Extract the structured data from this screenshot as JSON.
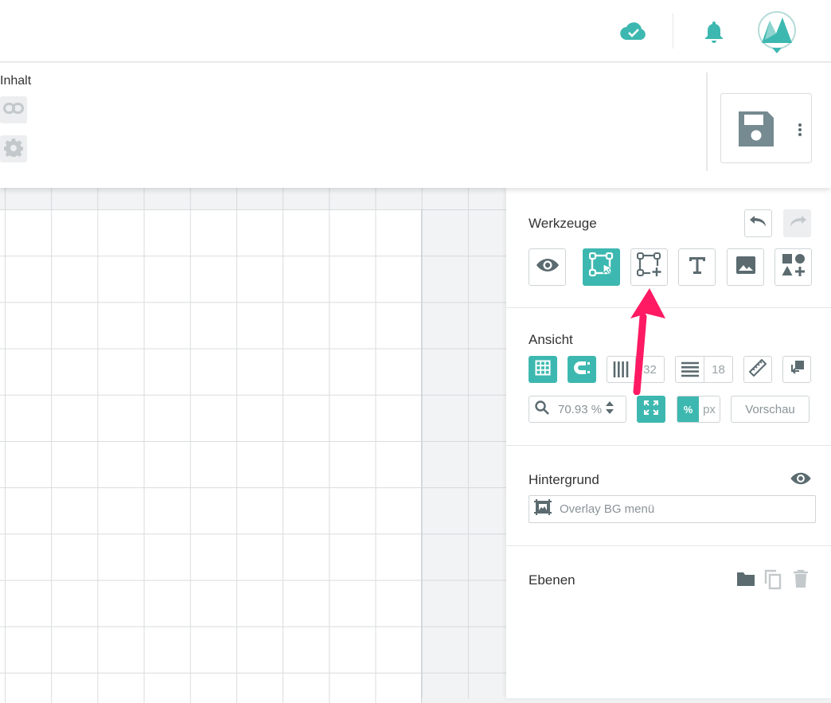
{
  "content": {
    "label": "Inhalt"
  },
  "tools": {
    "title": "Werkzeuge"
  },
  "view": {
    "title": "Ansicht",
    "columns": "32",
    "rows": "18",
    "zoom": "70.93 %",
    "unit_percent": "%",
    "unit_px": "px",
    "preview": "Vorschau"
  },
  "background": {
    "title": "Hintergrund",
    "placeholder": "Overlay BG menü"
  },
  "layers": {
    "title": "Ebenen"
  },
  "colors": {
    "accent": "#3db8b0",
    "icon": "#758a91",
    "annotation_arrow": "#ff1a63"
  }
}
